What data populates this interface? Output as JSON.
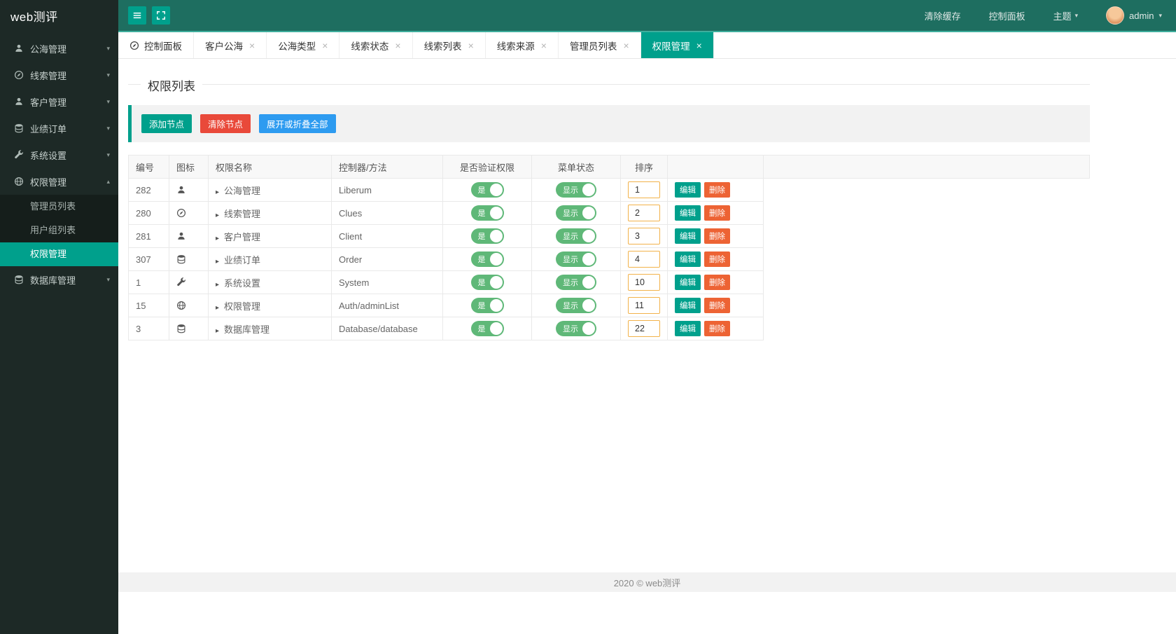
{
  "app": {
    "logo": "web测评"
  },
  "icons": {
    "close": "×",
    "caret": "▸",
    "chev_down": "▾",
    "chev_up": "▴"
  },
  "colors": {
    "accent": "#00a08c",
    "topbar": "#1e6e60",
    "sidebar": "#1d2926",
    "danger": "#e9493a",
    "info": "#2d9bf0",
    "delete": "#ed6334",
    "switch_on": "#5fb878",
    "sort_border": "#f2b24a"
  },
  "topbar": {
    "clear_cache": "清除缓存",
    "control_panel": "控制面板",
    "theme": "主题",
    "username": "admin"
  },
  "sidebar": {
    "items": [
      {
        "label": "公海管理",
        "icon": "user-icon"
      },
      {
        "label": "线索管理",
        "icon": "compass-icon"
      },
      {
        "label": "客户管理",
        "icon": "user-icon"
      },
      {
        "label": "业绩订单",
        "icon": "database-icon"
      },
      {
        "label": "系统设置",
        "icon": "wrench-icon"
      },
      {
        "label": "权限管理",
        "icon": "globe-icon"
      },
      {
        "label": "数据库管理",
        "icon": "database-icon"
      }
    ],
    "submenu": [
      {
        "label": "管理员列表"
      },
      {
        "label": "用户组列表"
      },
      {
        "label": "权限管理",
        "active": true
      }
    ]
  },
  "tabs": [
    {
      "label": "控制面板"
    },
    {
      "label": "客户公海"
    },
    {
      "label": "公海类型"
    },
    {
      "label": "线索状态"
    },
    {
      "label": "线索列表"
    },
    {
      "label": "线索来源"
    },
    {
      "label": "管理员列表"
    },
    {
      "label": "权限管理"
    }
  ],
  "page": {
    "title": "权限列表"
  },
  "toolbar": {
    "add": "添加节点",
    "clear": "清除节点",
    "expand": "展开或折叠全部"
  },
  "table": {
    "headers": [
      "编号",
      "图标",
      "权限名称",
      "控制器/方法",
      "是否验证权限",
      "菜单状态",
      "排序"
    ],
    "toggle_on": "是",
    "toggle_show": "显示",
    "actions": {
      "edit": "编辑",
      "delete": "删除"
    },
    "rows": [
      {
        "id": "282",
        "icon": "user-icon",
        "name": "公海管理",
        "controller": "Liberum",
        "sort": "1"
      },
      {
        "id": "280",
        "icon": "compass-icon",
        "name": "线索管理",
        "controller": "Clues",
        "sort": "2"
      },
      {
        "id": "281",
        "icon": "user-icon",
        "name": "客户管理",
        "controller": "Client",
        "sort": "3"
      },
      {
        "id": "307",
        "icon": "database-icon",
        "name": "业绩订单",
        "controller": "Order",
        "sort": "4"
      },
      {
        "id": "1",
        "icon": "wrench-icon",
        "name": "系统设置",
        "controller": "System",
        "sort": "10"
      },
      {
        "id": "15",
        "icon": "globe-icon",
        "name": "权限管理",
        "controller": "Auth/adminList",
        "sort": "11"
      },
      {
        "id": "3",
        "icon": "database-icon",
        "name": "数据库管理",
        "controller": "Database/database",
        "sort": "22"
      }
    ]
  },
  "footer": {
    "text": "2020 ©  web测评"
  }
}
